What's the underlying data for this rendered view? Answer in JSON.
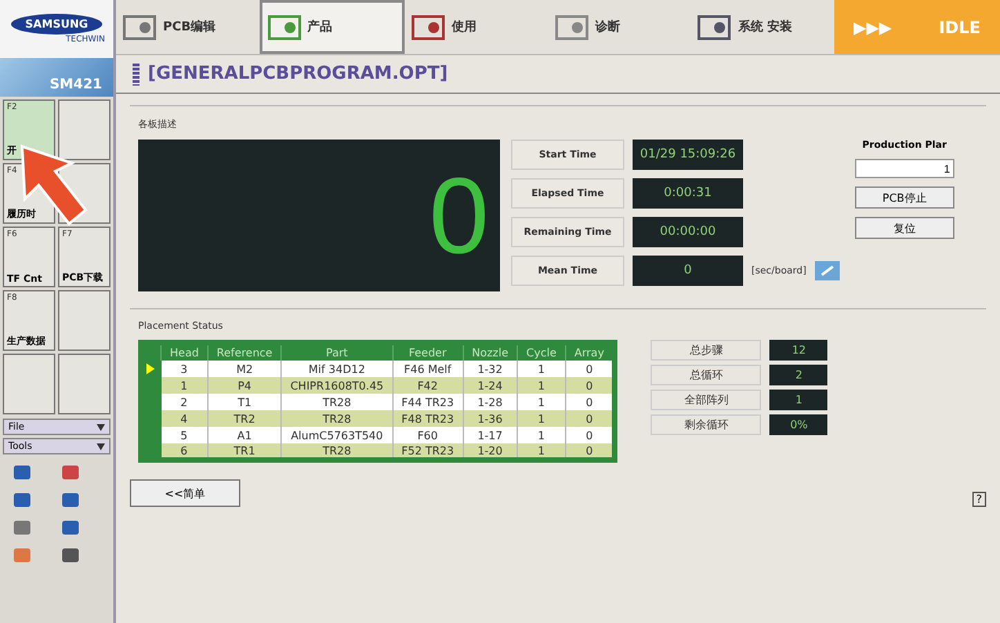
{
  "logo": {
    "brand": "SAMSUNG",
    "sub": "TECHWIN",
    "product": "SM421"
  },
  "tabs": [
    {
      "label": "PCB编辑",
      "selected": false
    },
    {
      "label": "产品",
      "selected": true
    },
    {
      "label": "使用",
      "selected": false
    },
    {
      "label": "诊断",
      "selected": false
    },
    {
      "label": "系统 安装",
      "selected": false
    }
  ],
  "status": {
    "arrows": "▶▶▶",
    "label": "IDLE"
  },
  "program_title": "[GENERALPCBPROGRAM.OPT]",
  "sidebar": {
    "keys": [
      {
        "key": "F2",
        "label": "开",
        "selected": true
      },
      {
        "selected": false
      },
      {
        "key": "F4",
        "label": "履历时",
        "selected": false
      },
      {
        "selected": false
      },
      {
        "key": "F6",
        "label": "TF Cnt",
        "selected": false
      },
      {
        "key": "F7",
        "label": "PCB下载",
        "selected": false
      },
      {
        "key": "F8",
        "label": "生产数据",
        "selected": false
      },
      {
        "selected": false
      },
      {
        "selected": false
      },
      {
        "selected": false
      }
    ],
    "menus": [
      "File",
      "Tools"
    ]
  },
  "board_panel": {
    "title": "各板描述",
    "count": "0",
    "times": [
      {
        "label": "Start Time",
        "value": "01/29 15:09:26"
      },
      {
        "label": "Elapsed Time",
        "value": "0:00:31"
      },
      {
        "label": "Remaining Time",
        "value": "00:00:00"
      },
      {
        "label": "Mean Time",
        "value": "0"
      }
    ],
    "unit": "[sec/board]",
    "production_plan": {
      "label": "Production Plar",
      "value": "1"
    },
    "buttons": [
      "PCB停止",
      "复位"
    ]
  },
  "placement": {
    "title": "Placement Status",
    "columns": [
      "Head",
      "Reference",
      "Part",
      "Feeder",
      "Nozzle",
      "Cycle",
      "Array"
    ],
    "rows": [
      {
        "cells": [
          "3",
          "M2",
          "Mif 34D12",
          "F46 Melf",
          "1-32",
          "1",
          "0"
        ],
        "selected": true
      },
      {
        "cells": [
          "1",
          "P4",
          "CHIPR1608T0.45",
          "F42",
          "1-24",
          "1",
          "0"
        ],
        "selected": false
      },
      {
        "cells": [
          "2",
          "T1",
          "TR28",
          "F44 TR23",
          "1-28",
          "1",
          "0"
        ],
        "selected": false
      },
      {
        "cells": [
          "4",
          "TR2",
          "TR28",
          "F48 TR23",
          "1-36",
          "1",
          "0"
        ],
        "selected": false
      },
      {
        "cells": [
          "5",
          "A1",
          "AlumC5763T540",
          "F60",
          "1-17",
          "1",
          "0"
        ],
        "selected": false
      },
      {
        "cells": [
          "6",
          "TR1",
          "TR28",
          "F52 TR23",
          "1-20",
          "1",
          "0"
        ],
        "selected": false
      }
    ],
    "stats": [
      {
        "label": "总步骤",
        "value": "12"
      },
      {
        "label": "总循环",
        "value": "2"
      },
      {
        "label": "全部阵列",
        "value": "1"
      },
      {
        "label": "剩余循环",
        "value": "0%"
      }
    ]
  },
  "simple_button": "<<简单",
  "corner_icon": "?"
}
